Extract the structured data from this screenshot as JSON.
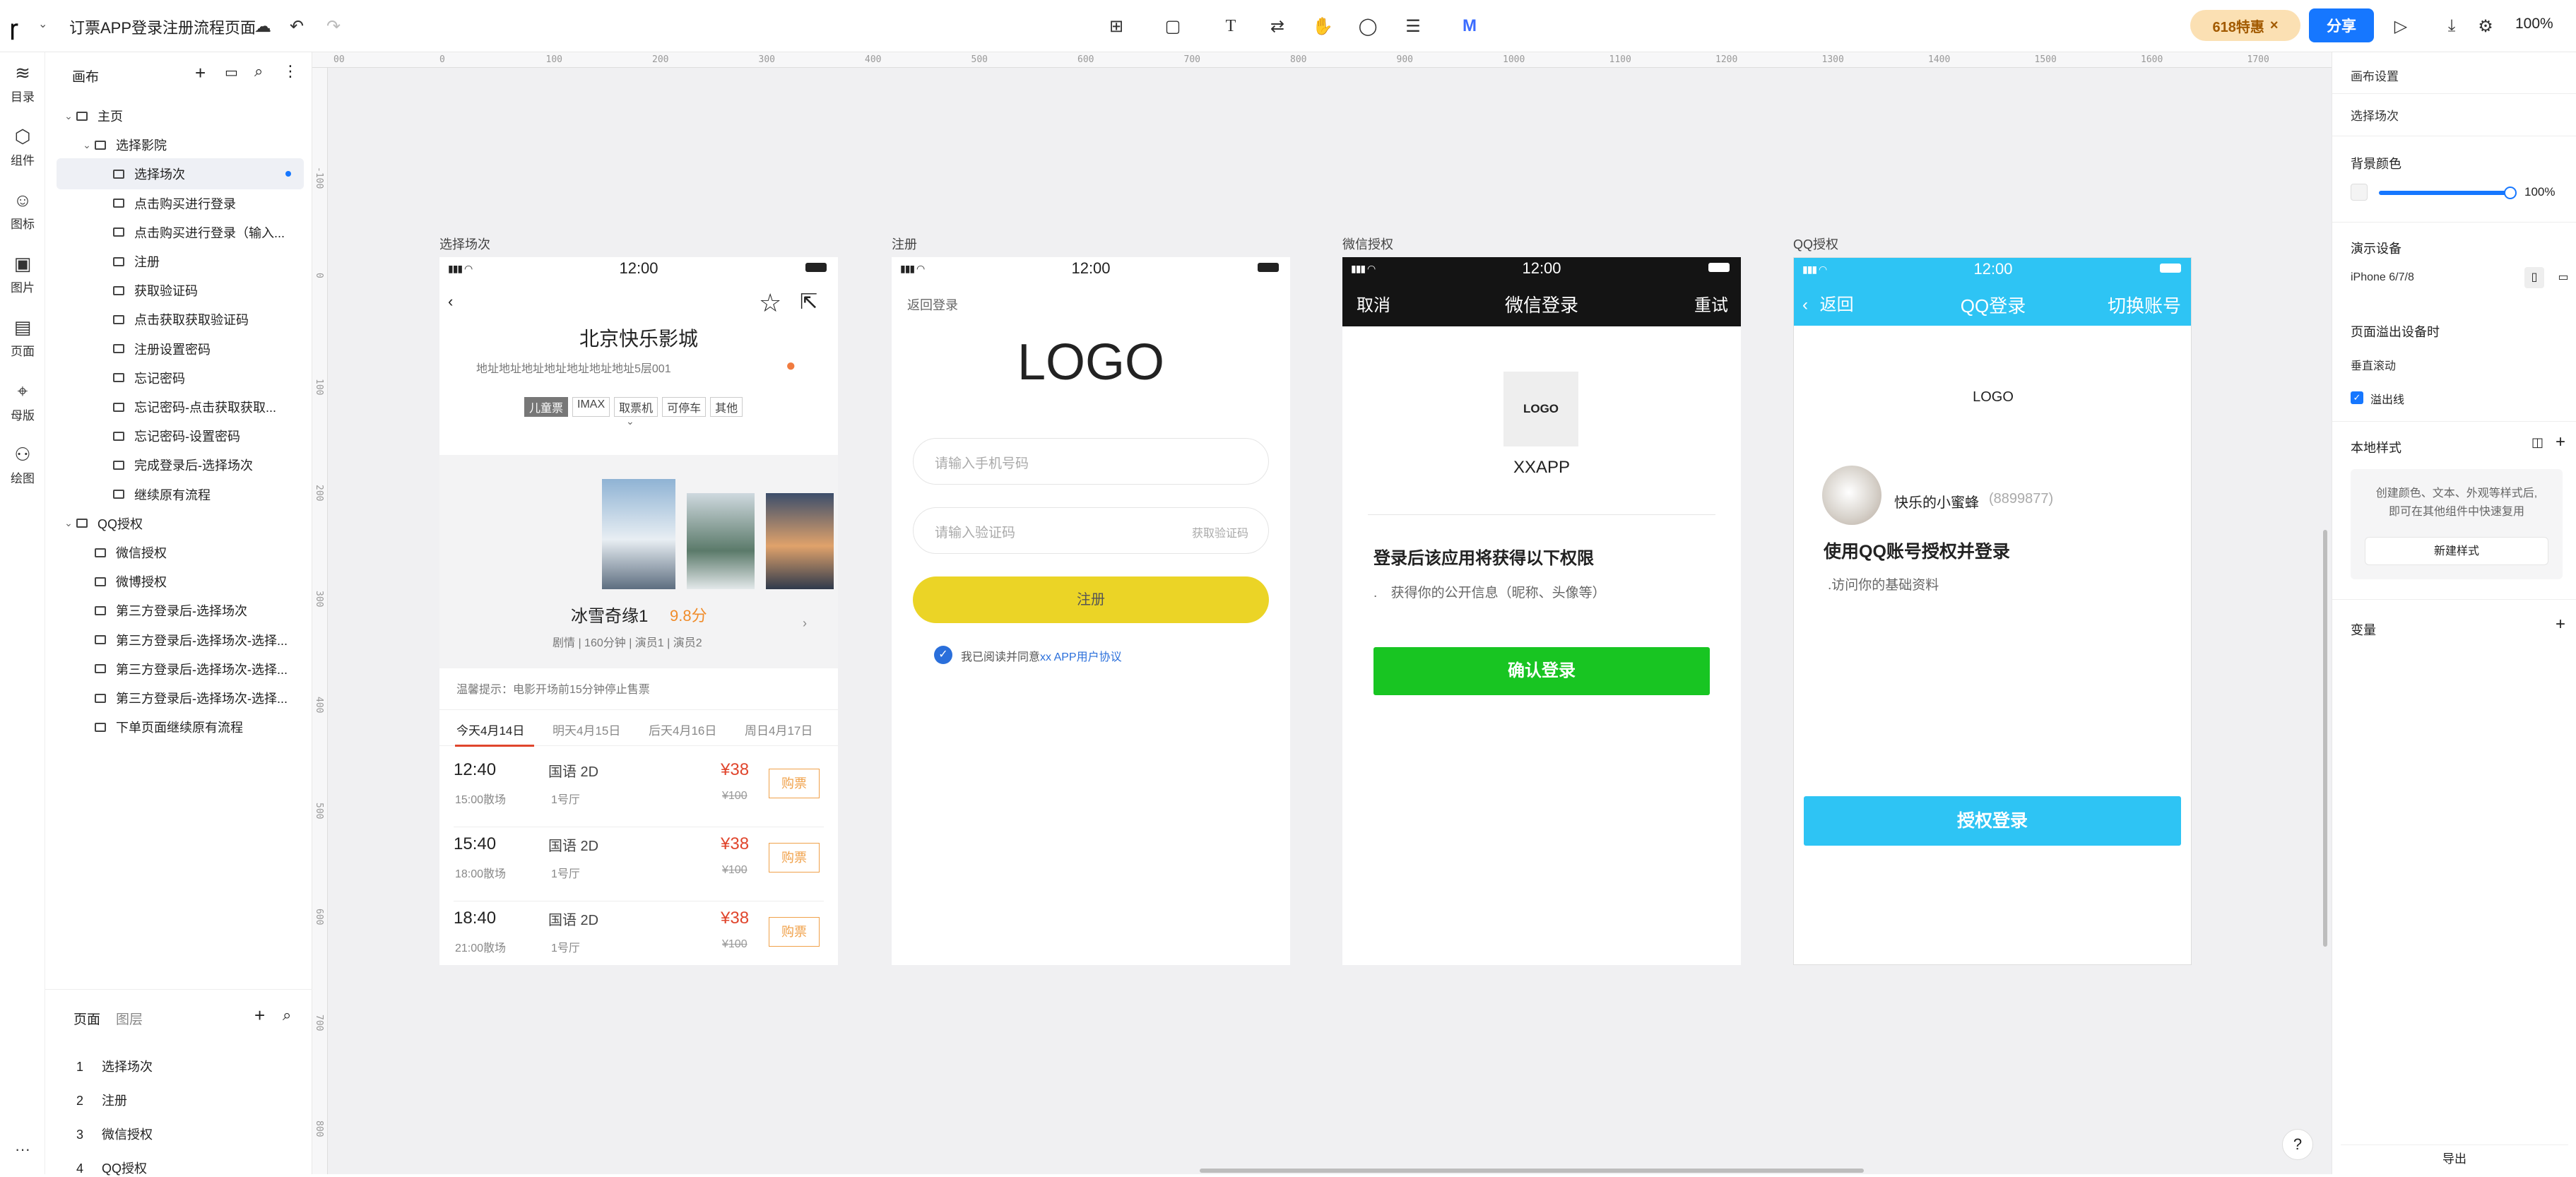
{
  "topbar": {
    "doc_title": "订票APP登录注册流程页面",
    "logo_glyph": "ꞅ",
    "promo_text": "618特惠",
    "share_label": "分享",
    "zoom": "100%"
  },
  "leftrail": {
    "items": [
      {
        "label": "目录",
        "icon": "layers-icon"
      },
      {
        "label": "组件",
        "icon": "component-icon"
      },
      {
        "label": "图标",
        "icon": "smile-icon"
      },
      {
        "label": "图片",
        "icon": "image-icon"
      },
      {
        "label": "页面",
        "icon": "page-icon"
      },
      {
        "label": "母版",
        "icon": "master-icon"
      },
      {
        "label": "绘图",
        "icon": "draw-icon"
      }
    ],
    "more": "···"
  },
  "layers": {
    "title": "画布",
    "tree": [
      {
        "label": "主页",
        "level": 0,
        "chevron": true
      },
      {
        "label": "选择影院",
        "level": 1,
        "chevron": true
      },
      {
        "label": "选择场次",
        "level": 2,
        "selected": true
      },
      {
        "label": "点击购买进行登录",
        "level": 2
      },
      {
        "label": "点击购买进行登录（输入...",
        "level": 2
      },
      {
        "label": "注册",
        "level": 2
      },
      {
        "label": "获取验证码",
        "level": 2
      },
      {
        "label": "点击获取获取验证码",
        "level": 2
      },
      {
        "label": "注册设置密码",
        "level": 2
      },
      {
        "label": "忘记密码",
        "level": 2
      },
      {
        "label": "忘记密码-点击获取获取...",
        "level": 2
      },
      {
        "label": "忘记密码-设置密码",
        "level": 2
      },
      {
        "label": "完成登录后-选择场次",
        "level": 2
      },
      {
        "label": "继续原有流程",
        "level": 2
      },
      {
        "label": "QQ授权",
        "level": 0,
        "chevron": true
      },
      {
        "label": "微信授权",
        "level": 1
      },
      {
        "label": "微博授权",
        "level": 1
      },
      {
        "label": "第三方登录后-选择场次",
        "level": 1
      },
      {
        "label": "第三方登录后-选择场次-选择...",
        "level": 1
      },
      {
        "label": "第三方登录后-选择场次-选择...",
        "level": 1
      },
      {
        "label": "第三方登录后-选择场次-选择...",
        "level": 1
      },
      {
        "label": "下单页面继续原有流程",
        "level": 1
      }
    ],
    "pages_tab": "页面",
    "layers_tab": "图层",
    "pages": [
      {
        "num": "1",
        "label": "选择场次"
      },
      {
        "num": "2",
        "label": "注册"
      },
      {
        "num": "3",
        "label": "微信授权"
      },
      {
        "num": "4",
        "label": "QQ授权"
      }
    ]
  },
  "ruler": {
    "h": [
      "00",
      "0",
      "100",
      "200",
      "300",
      "400",
      "500",
      "600",
      "700",
      "800",
      "900",
      "1000",
      "1100",
      "1200",
      "1300",
      "1400",
      "1500",
      "1600",
      "1700"
    ],
    "v": [
      "-100",
      "0",
      "100",
      "200",
      "300",
      "400",
      "500",
      "600",
      "700",
      "800"
    ]
  },
  "frames": {
    "f1": {
      "label": "选择场次",
      "time": "12:00",
      "cinema": "北京快乐影城",
      "address": "地址地址地址地址地址地址地址5层001",
      "tags": [
        "儿童票",
        "IMAX",
        "取票机",
        "可停车",
        "其他"
      ],
      "movie_title": "冰雪奇缘1",
      "score": "9.8分",
      "movie_meta": "剧情 | 160分钟 | 演员1 | 演员2",
      "notice": "温馨提示：电影开场前15分钟停止售票",
      "dates": [
        "今天4月14日",
        "明天4月15日",
        "后天4月16日",
        "周日4月17日"
      ],
      "sessions": [
        {
          "start": "12:40",
          "end": "15:00散场",
          "lang": "国语 2D",
          "hall": "1号厅",
          "price": "¥38",
          "orig": "¥100",
          "buy": "购票"
        },
        {
          "start": "15:40",
          "end": "18:00散场",
          "lang": "国语 2D",
          "hall": "1号厅",
          "price": "¥38",
          "orig": "¥100",
          "buy": "购票"
        },
        {
          "start": "18:40",
          "end": "21:00散场",
          "lang": "国语 2D",
          "hall": "1号厅",
          "price": "¥38",
          "orig": "¥100",
          "buy": "购票"
        }
      ]
    },
    "f2": {
      "label": "注册",
      "time": "12:00",
      "back": "返回登录",
      "logo": "LOGO",
      "phone_placeholder": "请输入手机号码",
      "code_placeholder": "请输入验证码",
      "get_code": "获取验证码",
      "register": "注册",
      "agree_prefix": "我已阅读并同意",
      "agree_link": "xx APP用户协议"
    },
    "f3": {
      "label": "微信授权",
      "time": "12:00",
      "cancel": "取消",
      "title": "微信登录",
      "retry": "重试",
      "logo": "LOGO",
      "app": "XXAPP",
      "heading": "登录后该应用将获得以下权限",
      "perm": "获得你的公开信息（昵称、头像等）",
      "confirm": "确认登录",
      "accent": "#18c522"
    },
    "f4": {
      "label": "QQ授权",
      "time": "12:00",
      "back": "返回",
      "title": "QQ登录",
      "switch": "切换账号",
      "logo": "LOGO",
      "nick": "快乐的小蜜蜂",
      "qq": "(8899877)",
      "heading": "使用QQ账号授权并登录",
      "perm": ".访问你的基础资料",
      "auth": "授权登录",
      "accent": "#2ec4f4"
    }
  },
  "rightpanel": {
    "canvas_settings": "画布设置",
    "current": "选择场次",
    "bg_color": "背景颜色",
    "opacity": "100%",
    "opacity_value": 1.0,
    "device": "演示设备",
    "device_value": "iPhone 6/7/8",
    "overflow": "页面溢出设备时",
    "scroll": "垂直滚动",
    "overflow_line": "溢出线",
    "local_styles": "本地样式",
    "styles_hint1": "创建颜色、文本、外观等样式后,",
    "styles_hint2": "即可在其他组件中快速复用",
    "new_style": "新建样式",
    "variables": "变量",
    "export": "导出"
  }
}
